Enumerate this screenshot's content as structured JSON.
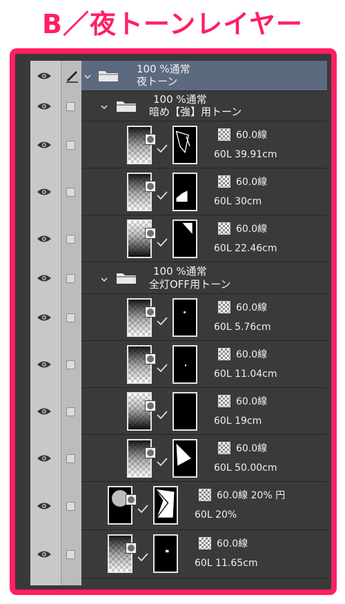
{
  "heading": "B／夜トーンレイヤー",
  "groups": [
    {
      "mode": "100 %通常",
      "name": "夜トーン"
    },
    {
      "mode": "100 %通常",
      "name": "暗め【強】用トーン"
    },
    {
      "mode": "100 %通常",
      "name": "全灯OFF用トーン"
    }
  ],
  "layers": [
    {
      "tone": "60.0線",
      "info": "60L 39.91cm"
    },
    {
      "tone": "60.0線",
      "info": "60L 30cm"
    },
    {
      "tone": "60.0線",
      "info": "60L 22.46cm"
    },
    {
      "tone": "60.0線",
      "info": "60L 5.76cm"
    },
    {
      "tone": "60.0線",
      "info": "60L 11.04cm"
    },
    {
      "tone": "60.0線",
      "info": "60L 19cm"
    },
    {
      "tone": "60.0線",
      "info": "60L 50.00cm"
    },
    {
      "tone": "60.0線 20% 円",
      "info": "60L 20%"
    },
    {
      "tone": "60.0線",
      "info": "60L 11.65cm"
    }
  ],
  "icons": {
    "visibility": "eye-icon",
    "edit": "pen-icon",
    "folder": "folder-icon",
    "expand": "chevron-down-icon",
    "tone": "tone-pattern-icon"
  },
  "colors": {
    "accent": "#ff1f63",
    "selected_row": "#5c6a80",
    "panel": "#3a3a3a"
  }
}
